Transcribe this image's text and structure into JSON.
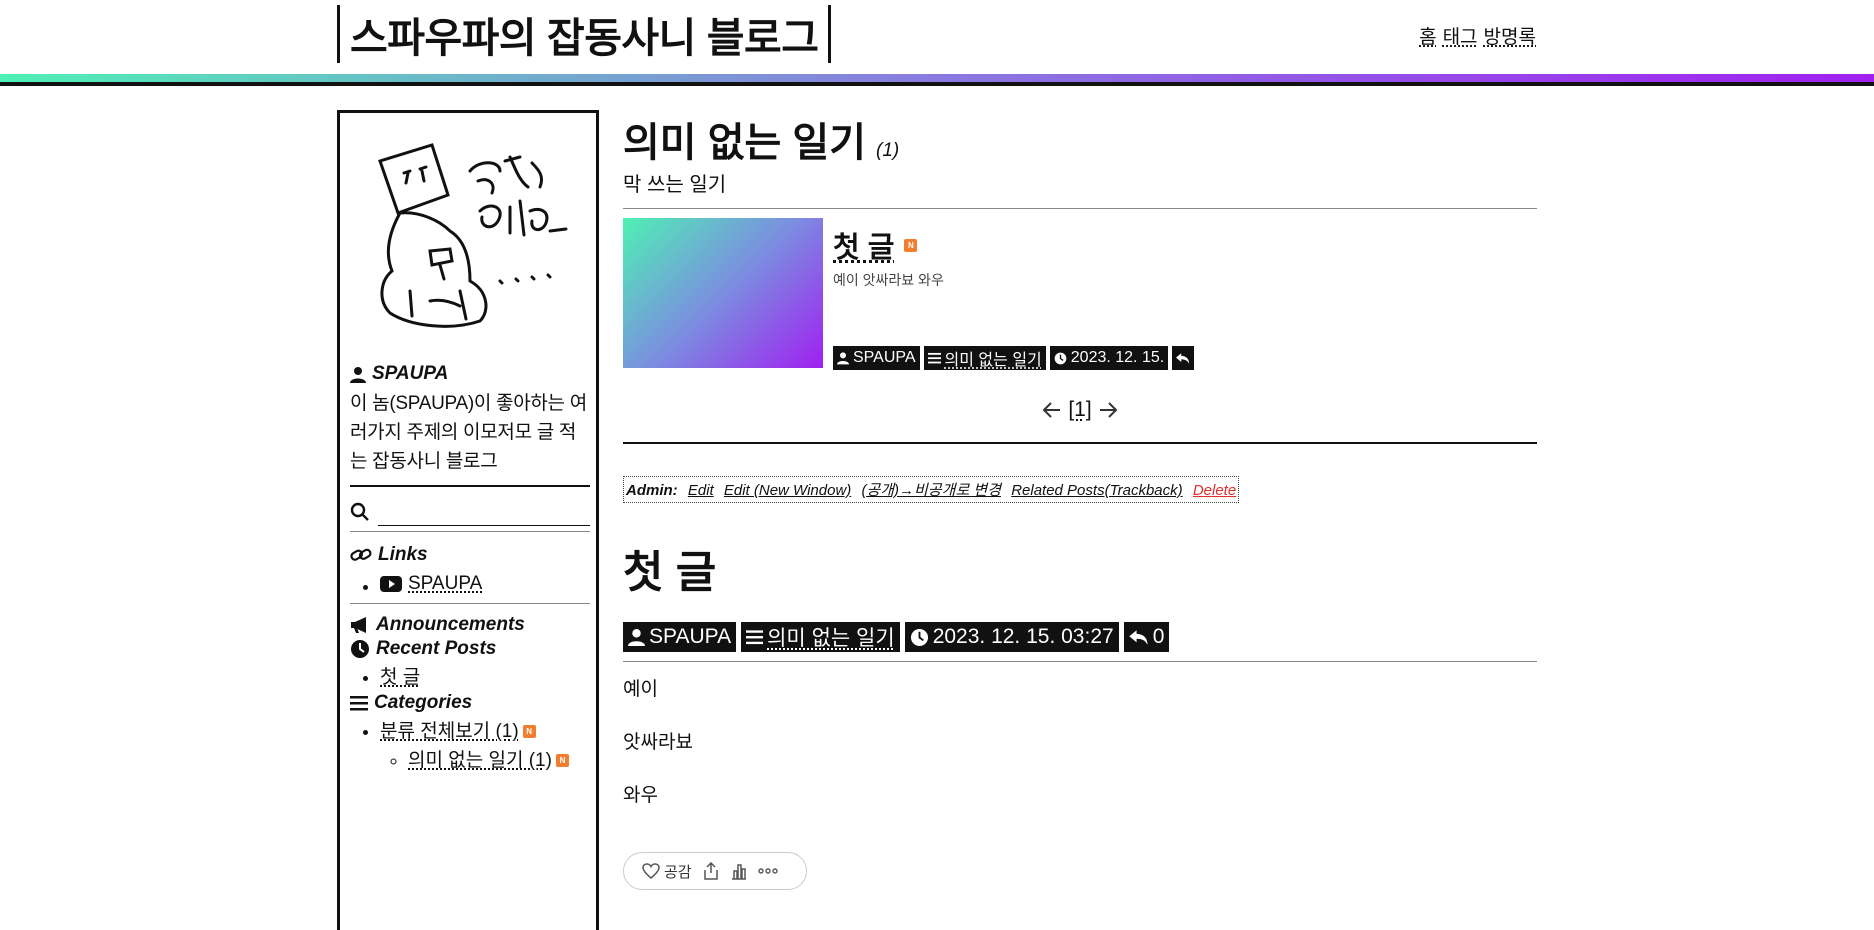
{
  "header": {
    "site_title": "스파우파의 잡동사니 블로그",
    "nav": [
      "홈",
      "태그",
      "방명록"
    ],
    "gradient_colors": [
      "#4ff0b4",
      "#8a7ae0",
      "#a020f0"
    ]
  },
  "sidebar": {
    "profile_name": "SPAUPA",
    "profile_desc": "이 놈(SPAUPA)이 좋아하는 여러가지 주제의 이모저모 글 적는 잡동사니 블로그",
    "search_placeholder": "",
    "links_heading": "Links",
    "links": [
      {
        "icon": "youtube-icon",
        "label": "SPAUPA"
      }
    ],
    "announcements_heading": "Announcements",
    "recent_heading": "Recent Posts",
    "recent_posts": [
      "첫 글"
    ],
    "categories_heading": "Categories",
    "categories": {
      "all": "분류 전체보기 (1)",
      "sub": [
        "의미 없는 일기 (1)"
      ]
    },
    "new_badge": "N"
  },
  "main": {
    "category_title": "의미 없는 일기",
    "category_count": "(1)",
    "category_desc": "막 쓰는 일기",
    "card": {
      "title": "첫 글",
      "excerpt": "예이 앗싸라뵤 와우",
      "author": "SPAUPA",
      "category": "의미 없는 일기",
      "date": "2023. 12. 15."
    },
    "pager": {
      "current": "[1]"
    },
    "admin": {
      "label": "Admin:",
      "edit": "Edit",
      "edit_new_window": "Edit (New Window)",
      "visibility": "(공개)→비공개로 변경",
      "related": "Related Posts(Trackback)",
      "delete": "Delete"
    },
    "post": {
      "title": "첫 글",
      "author": "SPAUPA",
      "category": "의미 없는 일기",
      "datetime": "2023. 12. 15. 03:27",
      "comments": "0",
      "paragraphs": [
        "예이",
        "앗싸라뵤",
        "와우"
      ]
    },
    "reactions": {
      "like_label": "공감"
    }
  }
}
